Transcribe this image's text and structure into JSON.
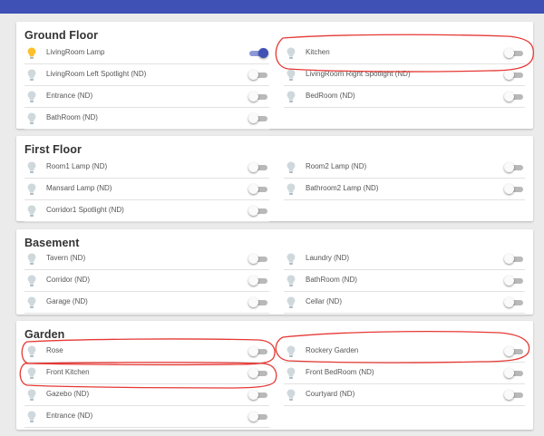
{
  "sections": [
    {
      "title": "Ground Floor",
      "left": [
        {
          "label": "LivingRoom Lamp",
          "on": true
        },
        {
          "label": "LivingRoom Left Spotlight (ND)",
          "on": false
        },
        {
          "label": "Entrance (ND)",
          "on": false
        },
        {
          "label": "BathRoom (ND)",
          "on": false
        }
      ],
      "right": [
        {
          "label": "Kitchen",
          "on": false
        },
        {
          "label": "LivingRoom Right Spotlight (ND)",
          "on": false
        },
        {
          "label": "BedRoom (ND)",
          "on": false
        }
      ]
    },
    {
      "title": "First Floor",
      "left": [
        {
          "label": "Room1 Lamp (ND)",
          "on": false
        },
        {
          "label": "Mansard Lamp (ND)",
          "on": false
        },
        {
          "label": "Corridor1 Spotlight (ND)",
          "on": false
        }
      ],
      "right": [
        {
          "label": "Room2 Lamp (ND)",
          "on": false
        },
        {
          "label": "Bathroom2 Lamp (ND)",
          "on": false
        }
      ]
    },
    {
      "title": "Basement",
      "left": [
        {
          "label": "Tavern (ND)",
          "on": false
        },
        {
          "label": "Corridor (ND)",
          "on": false
        },
        {
          "label": "Garage (ND)",
          "on": false
        }
      ],
      "right": [
        {
          "label": "Laundry (ND)",
          "on": false
        },
        {
          "label": "BathRoom (ND)",
          "on": false
        },
        {
          "label": "Cellar (ND)",
          "on": false
        }
      ]
    },
    {
      "title": "Garden",
      "left": [
        {
          "label": "Rose",
          "on": false
        },
        {
          "label": "Front Kitchen",
          "on": false
        },
        {
          "label": "Gazebo (ND)",
          "on": false
        },
        {
          "label": "Entrance (ND)",
          "on": false
        }
      ],
      "right": [
        {
          "label": "Rockery Garden",
          "on": false
        },
        {
          "label": "Front BedRoom (ND)",
          "on": false
        },
        {
          "label": "Courtyard (ND)",
          "on": false
        }
      ]
    }
  ],
  "colors": {
    "appbar": "#3f51b5",
    "bulb_on": "#fbc02d",
    "bulb_off": "#cfd8dc",
    "switch_on": "#3f51b5",
    "annotation": "#e53935"
  },
  "icons": {
    "light": "lightbulb-icon"
  }
}
